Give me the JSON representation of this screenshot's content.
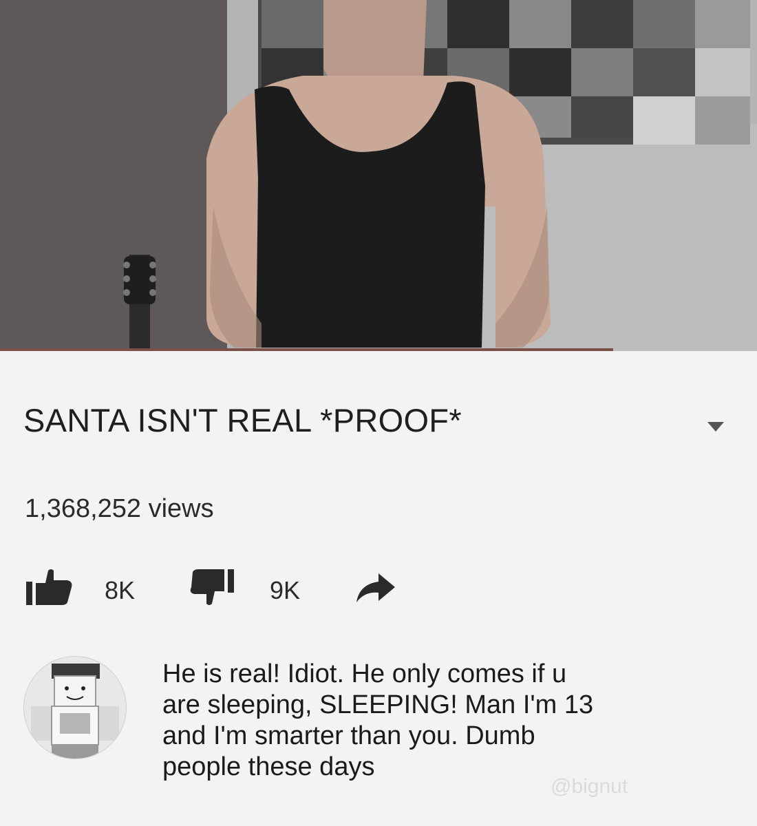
{
  "video": {
    "title": "SANTA ISN'T REAL *PROOF*",
    "views": "1,368,252 views",
    "progress_fraction": 0.81
  },
  "actions": {
    "like_count": "8K",
    "dislike_count": "9K"
  },
  "icons": {
    "like": "thumbs-up-icon",
    "dislike": "thumbs-down-icon",
    "share": "share-arrow-icon",
    "expand": "chevron-down-icon"
  },
  "comment": {
    "lines": [
      "He is real! Idiot. He only comes if u",
      "are sleeping, SLEEPING! Man I'm 13",
      "and I'm smarter than you. Dumb",
      "people these days"
    ]
  },
  "watermark": "@bignut",
  "colors": {
    "background": "#f3f3f3",
    "text": "#1f1f1f",
    "icon": "#2a2a2a"
  }
}
